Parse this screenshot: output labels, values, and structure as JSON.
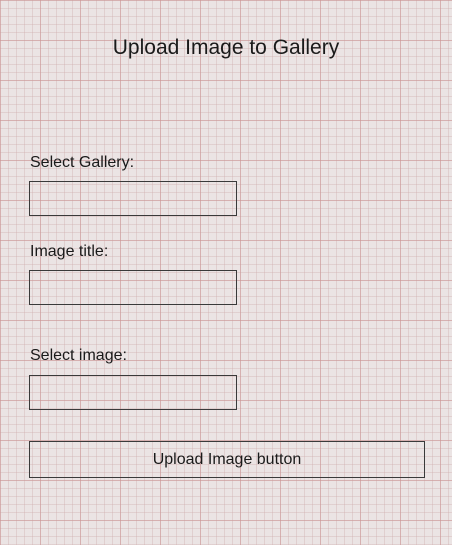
{
  "page": {
    "title": "Upload Image to Gallery"
  },
  "form": {
    "gallery_label": "Select Gallery:",
    "gallery_value": "",
    "title_label": "Image title:",
    "title_value": "",
    "image_label": "Select image:",
    "image_value": "",
    "upload_button_label": "Upload Image button"
  }
}
